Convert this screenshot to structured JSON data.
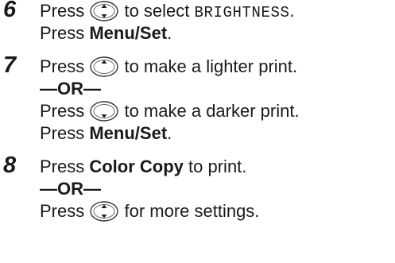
{
  "steps": [
    {
      "number": "6",
      "lines": [
        {
          "pre": "Press ",
          "icon": "updown",
          "post_plain": " to select ",
          "post_mono": "BRIGHTNESS",
          "post_end": "."
        },
        {
          "pre": "Press ",
          "bold": "Menu/Set",
          "end": "."
        }
      ]
    },
    {
      "number": "7",
      "lines": [
        {
          "pre": "Press ",
          "icon": "up",
          "post": " to make a lighter print."
        },
        {
          "separator": "—OR—"
        },
        {
          "pre": "Press ",
          "icon": "down",
          "post": " to make a darker print."
        },
        {
          "pre": "Press ",
          "bold": "Menu/Set",
          "end": "."
        }
      ]
    },
    {
      "number": "8",
      "lines": [
        {
          "pre": "Press ",
          "bold": "Color Copy",
          "end": " to print."
        },
        {
          "separator": "—OR—"
        },
        {
          "pre": "Press ",
          "icon": "updown",
          "post": " for more settings."
        }
      ]
    }
  ],
  "icons": {
    "updown": "navigation-key-up-down-icon",
    "up": "navigation-key-up-icon",
    "down": "navigation-key-down-icon"
  }
}
